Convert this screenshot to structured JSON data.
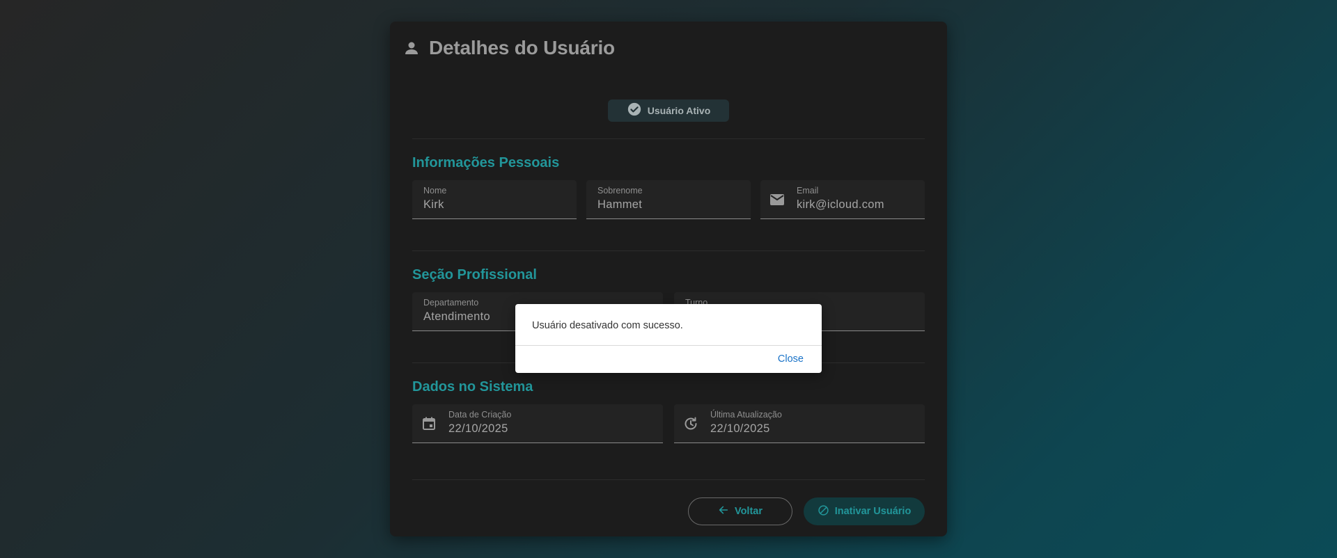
{
  "header": {
    "title": "Detalhes do Usuário",
    "icon": "person-icon"
  },
  "status": {
    "label": "Usuário Ativo",
    "icon": "check-circle-icon"
  },
  "sections": {
    "personal": {
      "title": "Informações Pessoais",
      "fields": {
        "first_name": {
          "label": "Nome",
          "value": "Kirk"
        },
        "last_name": {
          "label": "Sobrenome",
          "value": "Hammet"
        },
        "email": {
          "label": "Email",
          "value": "kirk@icloud.com",
          "icon": "mail-icon"
        }
      }
    },
    "professional": {
      "title": "Seção Profissional",
      "fields": {
        "department": {
          "label": "Departamento",
          "value": "Atendimento"
        },
        "shift": {
          "label": "Turno",
          "value": ""
        }
      }
    },
    "system": {
      "title": "Dados no Sistema",
      "fields": {
        "created": {
          "label": "Data de Criação",
          "value": "22/10/2025",
          "icon": "calendar-icon"
        },
        "updated": {
          "label": "Última Atualização",
          "value": "22/10/2025",
          "icon": "history-icon"
        }
      }
    }
  },
  "actions": {
    "back_label": "Voltar",
    "deactivate_label": "Inativar Usuário"
  },
  "dialog": {
    "message": "Usuário desativado com sucesso.",
    "close_label": "Close"
  },
  "colors": {
    "accent": "#22969a",
    "card_bg": "#1c1c1c",
    "field_bg": "#232323",
    "link_blue": "#1a73c8"
  }
}
